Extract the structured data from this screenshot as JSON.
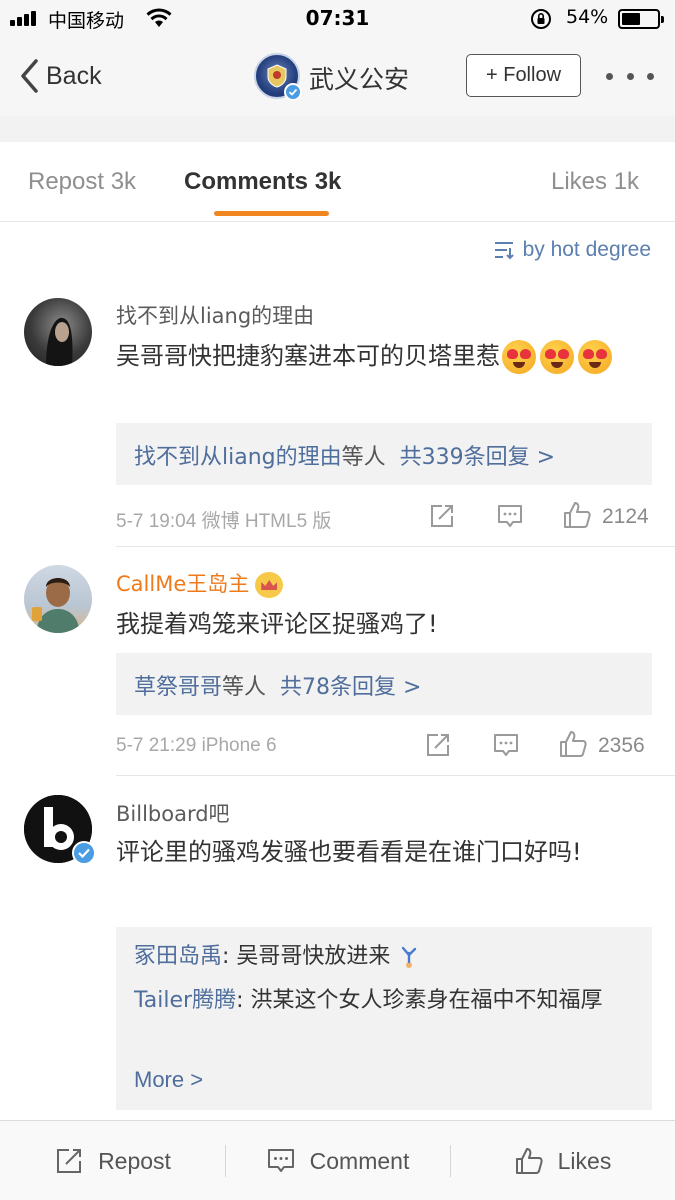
{
  "status_bar": {
    "carrier": "中国移动",
    "time": "07:31",
    "battery_percent": "54%",
    "battery_level": 0.54
  },
  "nav": {
    "back_label": "Back",
    "title": "武义公安",
    "follow_label": "+ Follow"
  },
  "tabs": {
    "repost": "Repost 3k",
    "comments": "Comments 3k",
    "likes": "Likes 1k"
  },
  "sort_label": "by hot degree",
  "comments": [
    {
      "name": "找不到从liang的理由",
      "text": "吴哥哥快把捷豹塞进本可的贝塔里惹",
      "reply_summary_user": "找不到从liang的理由",
      "reply_summary_mid": "等人",
      "reply_summary_count": "共339条回复 >",
      "meta": "5-7 19:04  微博 HTML5 版",
      "likes": "2124"
    },
    {
      "name": "CallMe王岛主",
      "text": "我提着鸡笼来评论区捉骚鸡了!",
      "reply_summary_user": "草祭哥哥",
      "reply_summary_mid": "等人",
      "reply_summary_count": "共78条回复 >",
      "meta": "5-7 21:29  iPhone 6",
      "likes": "2356"
    },
    {
      "name": "Billboard吧",
      "text": "评论里的骚鸡发骚也要看看是在谁门口好吗!",
      "replies": [
        {
          "user": "冢田岛禹",
          "text": ": 吴哥哥快放进来"
        },
        {
          "user": "Tailer腾腾",
          "text": ": 洪某这个女人珍素身在福中不知福厚"
        }
      ],
      "more_label": "More >"
    }
  ],
  "bottom_bar": {
    "repost": "Repost",
    "comment": "Comment",
    "likes": "Likes"
  }
}
